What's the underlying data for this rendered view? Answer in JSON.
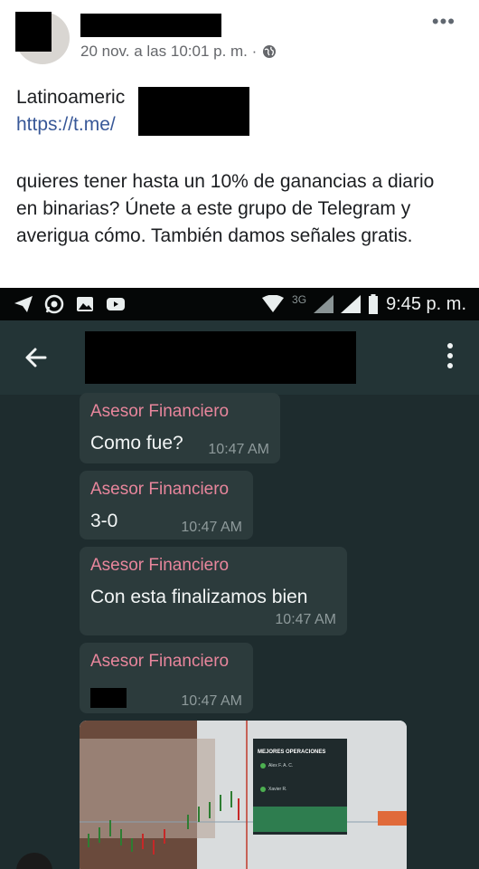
{
  "post": {
    "meta_time": "20 nov. a las 10:01 p. m. ·",
    "text_line1": "Latinoameric",
    "link": "https://t.me/",
    "body": "quieres tener hasta un 10% de ganancias a diario en binarias? Únete a este grupo de Telegram y averigua cómo. También damos señales gratis."
  },
  "phone": {
    "status_time": "9:45 p. m.",
    "network": "3G",
    "messages": [
      {
        "sender": "Asesor Financiero",
        "text": "Como fue?",
        "time": "10:47 AM"
      },
      {
        "sender": "Asesor Financiero",
        "text": "3-0",
        "time": "10:47 AM"
      },
      {
        "sender": "Asesor Financiero",
        "text": "Con esta finalizamos bien",
        "time": "10:47 AM"
      },
      {
        "sender": "Asesor Financiero",
        "text": "",
        "time": "10:47 AM"
      }
    ],
    "photo_panel": {
      "title": "MEJORES OPERACIONES",
      "row1": "Alex F. A. C.",
      "row2": "Xavier R."
    }
  },
  "colors": {
    "link": "#385898",
    "sender": "#e8869c",
    "chat_bg": "#1e2c2e",
    "bubble": "#2c3b3c"
  }
}
